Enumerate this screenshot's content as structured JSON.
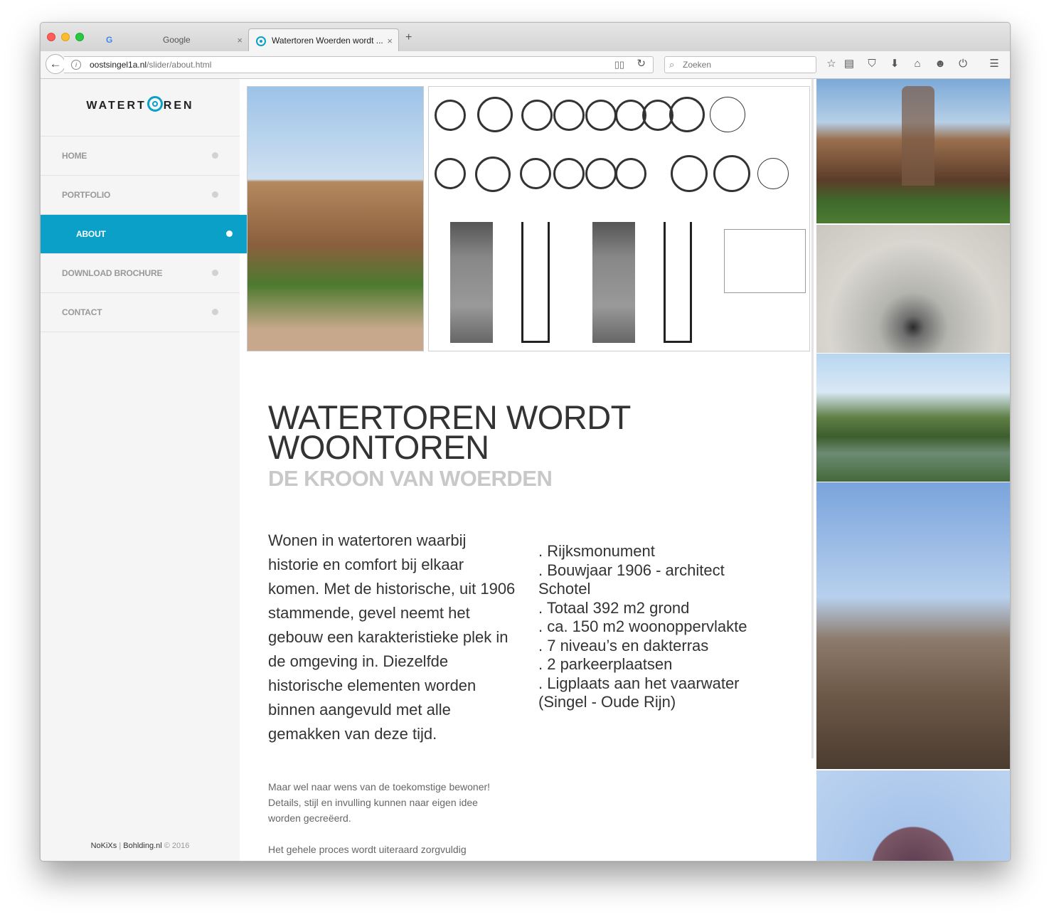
{
  "browser": {
    "tabs": [
      {
        "label": "Google",
        "active": false
      },
      {
        "label": "Watertoren Woerden wordt ...",
        "active": true
      }
    ],
    "new_tab": "+",
    "close_glyph": "×",
    "url_host": "oostsingel1a.nl",
    "url_path": "/slider/about.html",
    "search_placeholder": "Zoeken",
    "icons": [
      "back-icon",
      "info-icon",
      "reader-view-icon",
      "reload-icon",
      "search-icon",
      "bookmark-star-icon",
      "reading-list-icon",
      "pocket-icon",
      "download-icon",
      "home-icon",
      "smiley-icon",
      "power-icon",
      "menu-icon"
    ]
  },
  "sidebar": {
    "logo_left": "WATERT",
    "logo_right": "REN",
    "nav": [
      {
        "label": "HOME",
        "active": false
      },
      {
        "label": "PORTFOLIO",
        "active": false
      },
      {
        "label": "ABOUT",
        "active": true
      },
      {
        "label": "DOWNLOAD BROCHURE",
        "active": false
      },
      {
        "label": "CONTACT",
        "active": false
      }
    ],
    "footer": {
      "brand1": "NoKiXs",
      "sep": " | ",
      "brand2": "Bohlding.nl",
      "copy": " © 2016"
    }
  },
  "main": {
    "headline": "WATERTOREN WORDT WOONTOREN",
    "subhead": "DE KROON VAN WOERDEN",
    "lead": "Wonen in watertoren waarbij historie en comfort bij elkaar komen. Met de historische, uit 1906 stammende, gevel neemt het gebouw een karakteristieke plek in de omgeving in. Diezelfde historische elementen worden binnen aangevuld met alle gemakken van deze tijd.",
    "features": [
      ". Rijksmonument",
      ". Bouwjaar 1906 - architect Schotel",
      ". Totaal 392 m2 grond",
      ". ca. 150 m2 woonoppervlakte",
      ". 7 niveau’s en dakterras",
      ". 2 parkeerplaatsen",
      ". Ligplaats aan het vaarwater (Singel - Oude Rijn)"
    ],
    "small1": "Maar wel naar wens van de toekomstige bewoner! Details, stijl en invulling kunnen naar eigen idee worden gecreëerd.",
    "small2": "Het gehele proces wordt uiteraard zorgvuldig"
  },
  "colors": {
    "accent": "#0aa0c8",
    "nav_text": "#999999",
    "subhead": "#c8c8c8"
  }
}
